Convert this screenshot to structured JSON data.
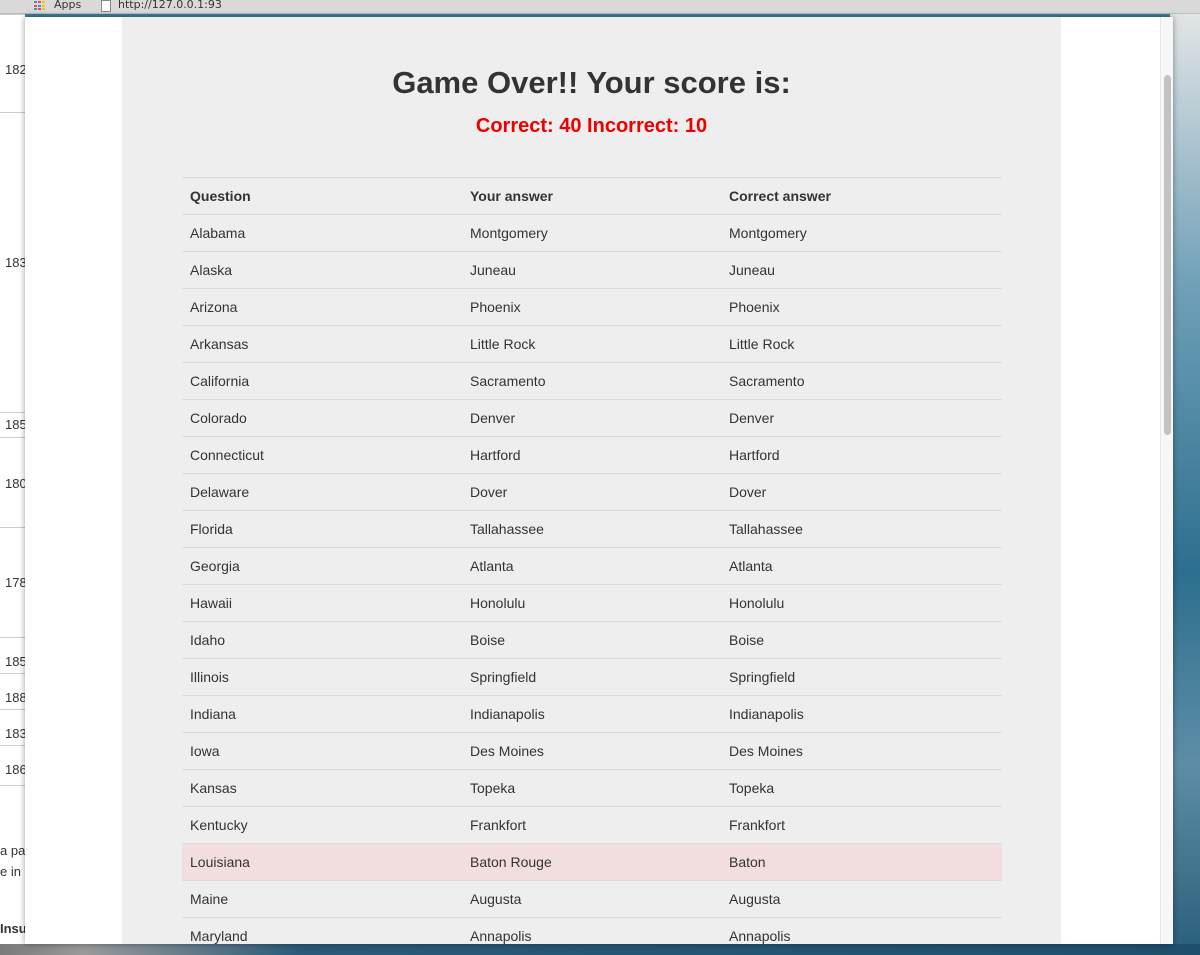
{
  "browser": {
    "apps_label": "Apps",
    "url": "http://127.0.0.1:93"
  },
  "background_page": {
    "left_numbers": [
      "182",
      "183",
      "185",
      "180",
      "178",
      "185",
      "188",
      "183",
      "186"
    ],
    "left_text": [
      "a pa",
      "e in",
      "Insu"
    ]
  },
  "game": {
    "title": "Game Over!! Your score is:",
    "score": "Correct: 40 Incorrect: 10",
    "headers": [
      "Question",
      "Your answer",
      "Correct answer"
    ],
    "rows": [
      {
        "question": "Alabama",
        "your_answer": "Montgomery",
        "correct_answer": "Montgomery",
        "correct": true
      },
      {
        "question": "Alaska",
        "your_answer": "Juneau",
        "correct_answer": "Juneau",
        "correct": true
      },
      {
        "question": "Arizona",
        "your_answer": "Phoenix",
        "correct_answer": "Phoenix",
        "correct": true
      },
      {
        "question": "Arkansas",
        "your_answer": "Little Rock",
        "correct_answer": "Little Rock",
        "correct": true
      },
      {
        "question": "California",
        "your_answer": "Sacramento",
        "correct_answer": "Sacramento",
        "correct": true
      },
      {
        "question": "Colorado",
        "your_answer": "Denver",
        "correct_answer": "Denver",
        "correct": true
      },
      {
        "question": "Connecticut",
        "your_answer": "Hartford",
        "correct_answer": "Hartford",
        "correct": true
      },
      {
        "question": "Delaware",
        "your_answer": "Dover",
        "correct_answer": "Dover",
        "correct": true
      },
      {
        "question": "Florida",
        "your_answer": "Tallahassee",
        "correct_answer": "Tallahassee",
        "correct": true
      },
      {
        "question": "Georgia",
        "your_answer": "Atlanta",
        "correct_answer": "Atlanta",
        "correct": true
      },
      {
        "question": "Hawaii",
        "your_answer": "Honolulu",
        "correct_answer": "Honolulu",
        "correct": true
      },
      {
        "question": "Idaho",
        "your_answer": "Boise",
        "correct_answer": "Boise",
        "correct": true
      },
      {
        "question": "Illinois",
        "your_answer": "Springfield",
        "correct_answer": "Springfield",
        "correct": true
      },
      {
        "question": "Indiana",
        "your_answer": "Indianapolis",
        "correct_answer": "Indianapolis",
        "correct": true
      },
      {
        "question": "Iowa",
        "your_answer": "Des Moines",
        "correct_answer": "Des Moines",
        "correct": true
      },
      {
        "question": "Kansas",
        "your_answer": "Topeka",
        "correct_answer": "Topeka",
        "correct": true
      },
      {
        "question": "Kentucky",
        "your_answer": "Frankfort",
        "correct_answer": "Frankfort",
        "correct": true
      },
      {
        "question": "Louisiana",
        "your_answer": "Baton Rouge",
        "correct_answer": "Baton",
        "correct": false
      },
      {
        "question": "Maine",
        "your_answer": "Augusta",
        "correct_answer": "Augusta",
        "correct": true
      },
      {
        "question": "Maryland",
        "your_answer": "Annapolis",
        "correct_answer": "Annapolis",
        "correct": true
      }
    ]
  },
  "colors": {
    "score_color": "#ee0000",
    "incorrect_row_bg": "#f2dede",
    "content_bg": "#eeeeee"
  }
}
